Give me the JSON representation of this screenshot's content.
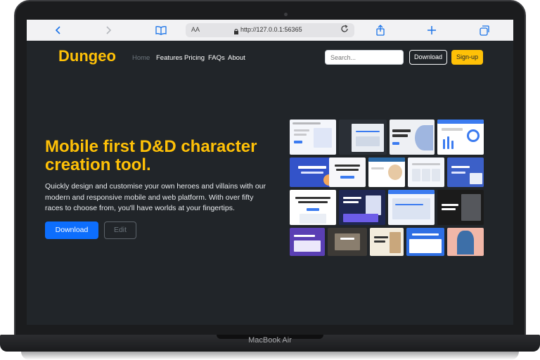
{
  "device": {
    "label": "MacBook Air"
  },
  "browser": {
    "reader_label": "AA",
    "url": "http://127.0.0.1:56365",
    "icons": [
      "back-icon",
      "forward-icon",
      "bookmarks-icon",
      "lock-icon",
      "reload-icon",
      "share-icon",
      "new-tab-icon",
      "tabs-icon"
    ]
  },
  "site": {
    "brand": "Dungeo",
    "nav": [
      "Home",
      "Features",
      "Pricing",
      "FAQs",
      "About"
    ],
    "search_placeholder": "Search...",
    "download_label": "Download",
    "signup_label": "Sign-up"
  },
  "hero": {
    "title": "Mobile first D&D character creation tool.",
    "text": "Quickly design and customise your own heroes and villains with our modern and responsive mobile and web platform. With over fifty races to choose from, you'll have worlds at your fingertips.",
    "primary_button": "Download",
    "secondary_button": "Edit"
  },
  "colors": {
    "accent": "#ffc107",
    "primary": "#0d6efd",
    "background": "#212529"
  }
}
